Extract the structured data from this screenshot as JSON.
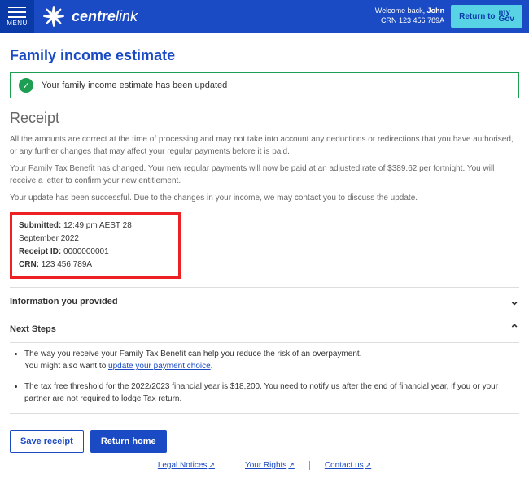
{
  "header": {
    "menu_label": "MENU",
    "brand_bold": "centre",
    "brand_light": "link",
    "welcome_prefix": "Welcome back, ",
    "welcome_name": "John",
    "crn_label": "CRN 123 456 789A",
    "return_btn_text": "Return to",
    "return_btn_my": "my",
    "return_btn_gov": "Gov"
  },
  "page": {
    "title": "Family income estimate",
    "success_msg": "Your family income estimate has been updated",
    "receipt_heading": "Receipt",
    "para1": "All the amounts are correct at the time of processing and may not take into account any deductions or redirections that you have authorised, or any further changes that may affect your regular payments before it is paid.",
    "para2": "Your Family Tax Benefit has changed. Your new regular payments will now be paid at an adjusted rate of $389.62 per fortnight. You will receive a letter to confirm your new entitlement.",
    "para3": "Your update has been successful. Due to the changes in your income, we may contact you to discuss the update."
  },
  "receipt_box": {
    "submitted_label": "Submitted:",
    "submitted_value": "12:49 pm AEST 28 September 2022",
    "receipt_id_label": "Receipt ID:",
    "receipt_id_value": "0000000001",
    "crn_label": "CRN:",
    "crn_value": " 123 456 789A"
  },
  "accordion1": {
    "title": "Information you provided"
  },
  "accordion2": {
    "title": "Next Steps"
  },
  "next_steps": {
    "item1_a": "The way you receive your Family Tax Benefit can help you reduce the risk of an overpayment.",
    "item1_b": "You might also want to ",
    "item1_link": "update your payment choice",
    "item2": "The tax free threshold for the 2022/2023 financial year is $18,200. You need to notify us after the end of financial year, if you or your partner are not required to lodge Tax return."
  },
  "buttons": {
    "save": "Save receipt",
    "home": "Return home"
  },
  "footer": {
    "legal": "Legal Notices",
    "rights": "Your Rights",
    "contact": "Contact us"
  }
}
